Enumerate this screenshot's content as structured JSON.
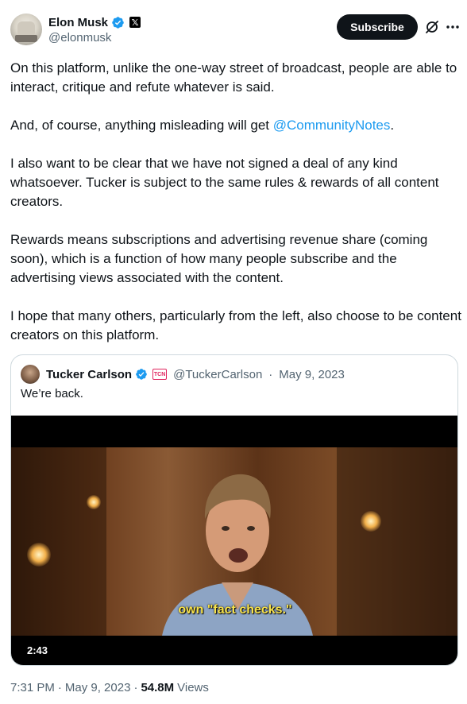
{
  "author": {
    "name": "Elon Musk",
    "handle": "@elonmusk",
    "affiliate_badge": "𝕏"
  },
  "header": {
    "subscribe_label": "Subscribe"
  },
  "tweet": {
    "paragraphs": [
      "On this platform, unlike the one-way street of broadcast, people are able to interact, critique and refute whatever is said.",
      "I also want to be clear that we have not signed a deal of any kind whatsoever. Tucker is subject to the same rules & rewards of all content creators.",
      "Rewards means subscriptions and advertising revenue share (coming soon), which is a function of how many people subscribe and the advertising views associated with the content.",
      "I hope that many others, particularly from the left, also choose to be content creators on this platform."
    ],
    "p2_prefix": "And, of course, anything misleading will get ",
    "p2_mention": "@CommunityNotes",
    "p2_suffix": "."
  },
  "quote": {
    "name": "Tucker Carlson",
    "badge_text": "TCN",
    "handle": "@TuckerCarlson",
    "separator": "·",
    "date": "May 9, 2023",
    "text": "We’re back.",
    "video": {
      "subtitle": "own \"fact checks.\"",
      "duration": "2:43"
    }
  },
  "footer": {
    "time": "7:31 PM",
    "separator": "·",
    "date": "May 9, 2023",
    "separator2": "·",
    "views_count": "54.8M",
    "views_label": "Views"
  },
  "colors": {
    "accent": "#1d9bf0",
    "text": "#0f1419",
    "secondary": "#536471",
    "border": "#cfd9de"
  }
}
